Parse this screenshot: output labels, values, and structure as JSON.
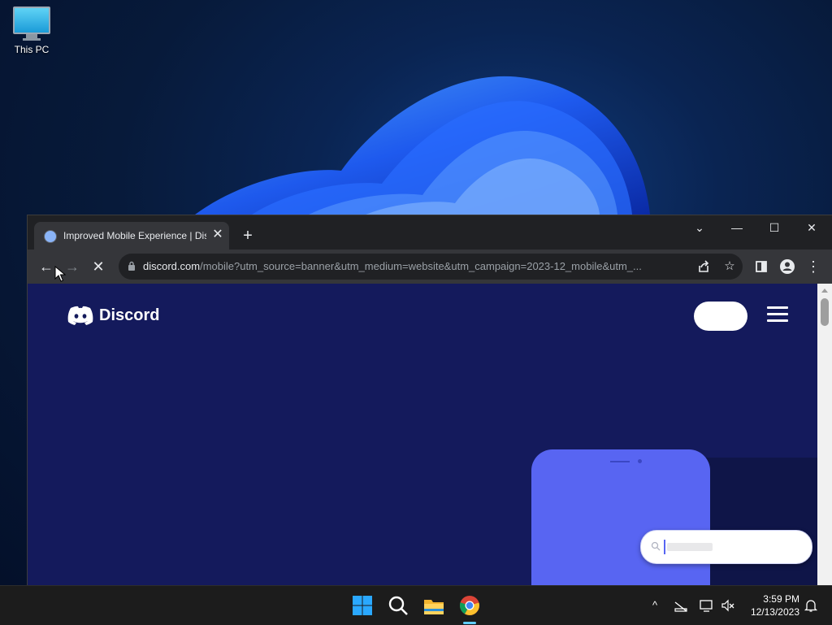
{
  "desktop": {
    "icons": [
      {
        "label": "This PC",
        "icon": "computer-icon"
      }
    ]
  },
  "browser": {
    "tab": {
      "title": "Improved Mobile Experience | Discord",
      "favicon": "loading-favicon-icon",
      "close_glyph": "✕"
    },
    "new_tab_glyph": "+",
    "window_controls": {
      "tab_search": "⌄",
      "minimize": "—",
      "maximize": "☐",
      "close": "✕"
    },
    "toolbar": {
      "back": "←",
      "forward": "→",
      "stop": "✕",
      "url_host": "discord.com",
      "url_path": "/mobile?utm_source=banner&utm_medium=website&utm_campaign=2023-12_mobile&utm_...",
      "share_icon": "share-icon",
      "bookmark_glyph": "☆",
      "side_panel_icon": "side-panel-icon",
      "profile_icon": "profile-icon",
      "menu_glyph": "⋮"
    }
  },
  "page": {
    "logo_text": "Discord",
    "colors": {
      "background": "#141a5c",
      "blurple": "#5865f2"
    }
  },
  "taskbar": {
    "apps": [
      "start-icon",
      "search-icon",
      "file-explorer-icon",
      "chrome-icon"
    ],
    "tray_chevron": "^",
    "clock": {
      "time": "3:59 PM",
      "date": "12/13/2023"
    }
  }
}
